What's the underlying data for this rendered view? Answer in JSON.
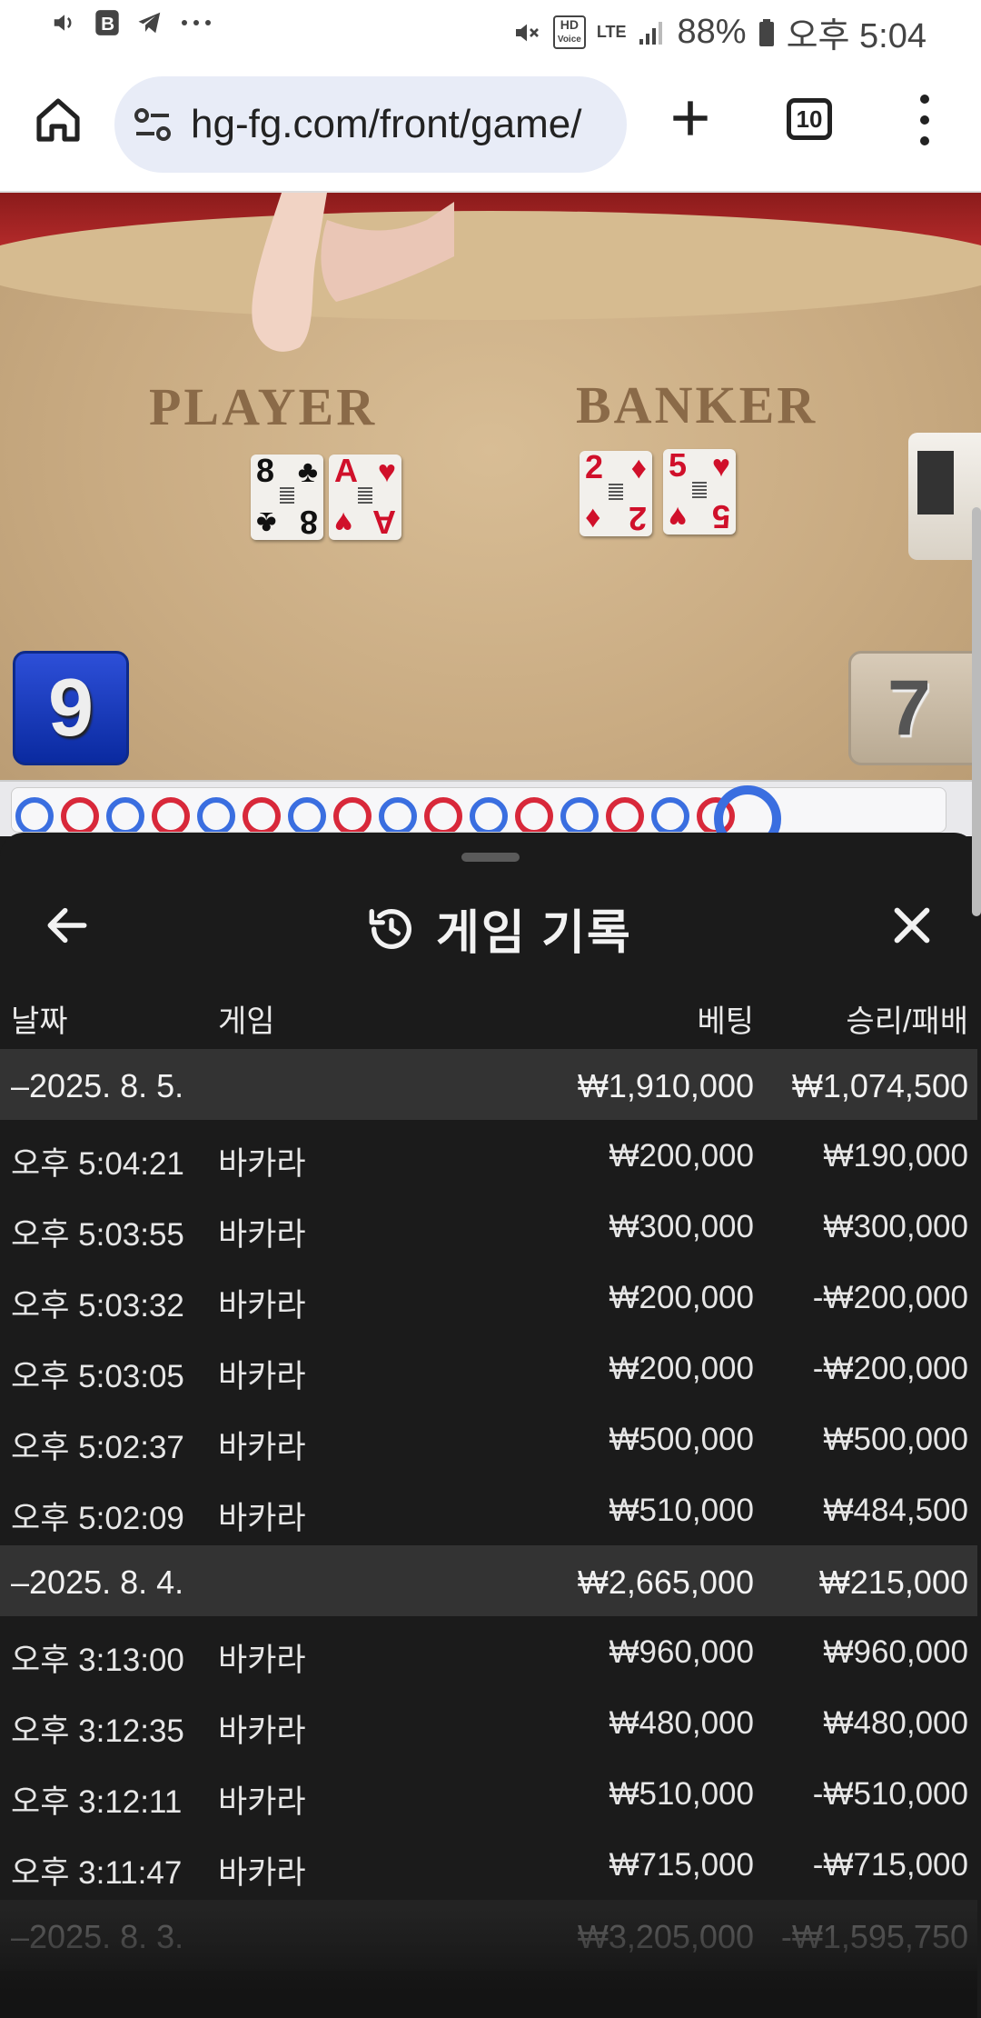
{
  "status_bar": {
    "time": "오후 5:04",
    "battery": "88%",
    "hd_line1": "HD",
    "hd_line2": "Voice",
    "lte": "LTE",
    "notification_icons": [
      "volume-icon",
      "b-icon",
      "telegram-icon",
      "more-icon"
    ]
  },
  "browser": {
    "url": "hg-fg.com/front/game/",
    "tab_count": "10"
  },
  "game": {
    "player_label": "PLAYER",
    "banker_label": "BANKER",
    "player_cards": [
      {
        "rank": "8",
        "suit": "♣",
        "color": "#111111"
      },
      {
        "rank": "A",
        "suit": "♥",
        "color": "#d0102a"
      }
    ],
    "banker_cards": [
      {
        "rank": "2",
        "suit": "♦",
        "color": "#d0102a"
      },
      {
        "rank": "5",
        "suit": "♥",
        "color": "#d0102a"
      }
    ],
    "player_score": "9",
    "banker_score": "7",
    "bead_road": [
      "b",
      "r",
      "b",
      "r",
      "b",
      "r",
      "b",
      "r",
      "b",
      "r",
      "b",
      "r",
      "b",
      "r",
      "b",
      "r"
    ]
  },
  "sheet": {
    "title": "게임 기록",
    "columns": {
      "date": "날짜",
      "game": "게임",
      "bet": "베팅",
      "result": "승리/패배"
    },
    "groups": [
      {
        "date": "–2025. 8. 5.",
        "bet_total": "₩1,910,000",
        "result_total": "₩1,074,500",
        "entries": [
          {
            "time": "오후 5:04:21",
            "game": "바카라",
            "bet": "₩200,000",
            "result": "₩190,000"
          },
          {
            "time": "오후 5:03:55",
            "game": "바카라",
            "bet": "₩300,000",
            "result": "₩300,000"
          },
          {
            "time": "오후 5:03:32",
            "game": "바카라",
            "bet": "₩200,000",
            "result": "-₩200,000"
          },
          {
            "time": "오후 5:03:05",
            "game": "바카라",
            "bet": "₩200,000",
            "result": "-₩200,000"
          },
          {
            "time": "오후 5:02:37",
            "game": "바카라",
            "bet": "₩500,000",
            "result": "₩500,000"
          },
          {
            "time": "오후 5:02:09",
            "game": "바카라",
            "bet": "₩510,000",
            "result": "₩484,500"
          }
        ]
      },
      {
        "date": "–2025. 8. 4.",
        "bet_total": "₩2,665,000",
        "result_total": "₩215,000",
        "entries": [
          {
            "time": "오후 3:13:00",
            "game": "바카라",
            "bet": "₩960,000",
            "result": "₩960,000"
          },
          {
            "time": "오후 3:12:35",
            "game": "바카라",
            "bet": "₩480,000",
            "result": "₩480,000"
          },
          {
            "time": "오후 3:12:11",
            "game": "바카라",
            "bet": "₩510,000",
            "result": "-₩510,000"
          },
          {
            "time": "오후 3:11:47",
            "game": "바카라",
            "bet": "₩715,000",
            "result": "-₩715,000"
          }
        ]
      },
      {
        "date": "–2025. 8. 3.",
        "bet_total": "₩3,205,000",
        "result_total": "-₩1,595,750",
        "entries": []
      }
    ]
  },
  "colors": {
    "sheet_bg": "#1b1b1b",
    "group_row_bg": "#333333",
    "player_blue": "#0a2aa0",
    "bead_blue": "#3a6ee0",
    "bead_red": "#d8283a"
  }
}
